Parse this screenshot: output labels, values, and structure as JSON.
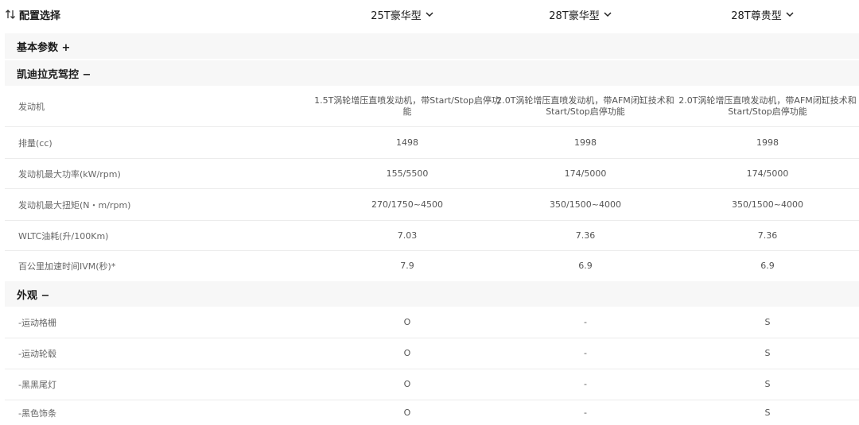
{
  "header": {
    "title": "配置选择",
    "models": [
      {
        "label": "25T豪华型"
      },
      {
        "label": "28T豪华型"
      },
      {
        "label": "28T尊贵型"
      }
    ]
  },
  "sections": {
    "basic": {
      "label": "基本参数 +"
    },
    "drive": {
      "label": "凯迪拉克驾控 −"
    },
    "exterior": {
      "label": "外观 −"
    }
  },
  "drive_rows": [
    {
      "name": "发动机",
      "values": [
        "1.5T涡轮增压直喷发动机，带Start/Stop启停功能",
        "2.0T涡轮增压直喷发动机，带AFM闭缸技术和Start/Stop启停功能",
        "2.0T涡轮增压直喷发动机，带AFM闭缸技术和Start/Stop启停功能"
      ]
    },
    {
      "name": "排量(cc)",
      "values": [
        "1498",
        "1998",
        "1998"
      ]
    },
    {
      "name": "发动机最大功率(kW/rpm)",
      "values": [
        "155/5500",
        "174/5000",
        "174/5000"
      ]
    },
    {
      "name": "发动机最大扭矩(N・m/rpm)",
      "values": [
        "270/1750~4500",
        "350/1500~4000",
        "350/1500~4000"
      ]
    },
    {
      "name": "WLTC油耗(升/100Km)",
      "values": [
        "7.03",
        "7.36",
        "7.36"
      ]
    },
    {
      "name": "百公里加速时间IVM(秒)*",
      "values": [
        "7.9",
        "6.9",
        "6.9"
      ]
    }
  ],
  "exterior_rows": [
    {
      "name": "-运动格栅",
      "values": [
        "O",
        "-",
        "S"
      ]
    },
    {
      "name": "-运动轮毂",
      "values": [
        "O",
        "-",
        "S"
      ]
    },
    {
      "name": "-黑黑尾灯",
      "values": [
        "O",
        "-",
        "S"
      ]
    },
    {
      "name": "-黑色饰条",
      "values": [
        "O",
        "-",
        "S"
      ]
    }
  ]
}
